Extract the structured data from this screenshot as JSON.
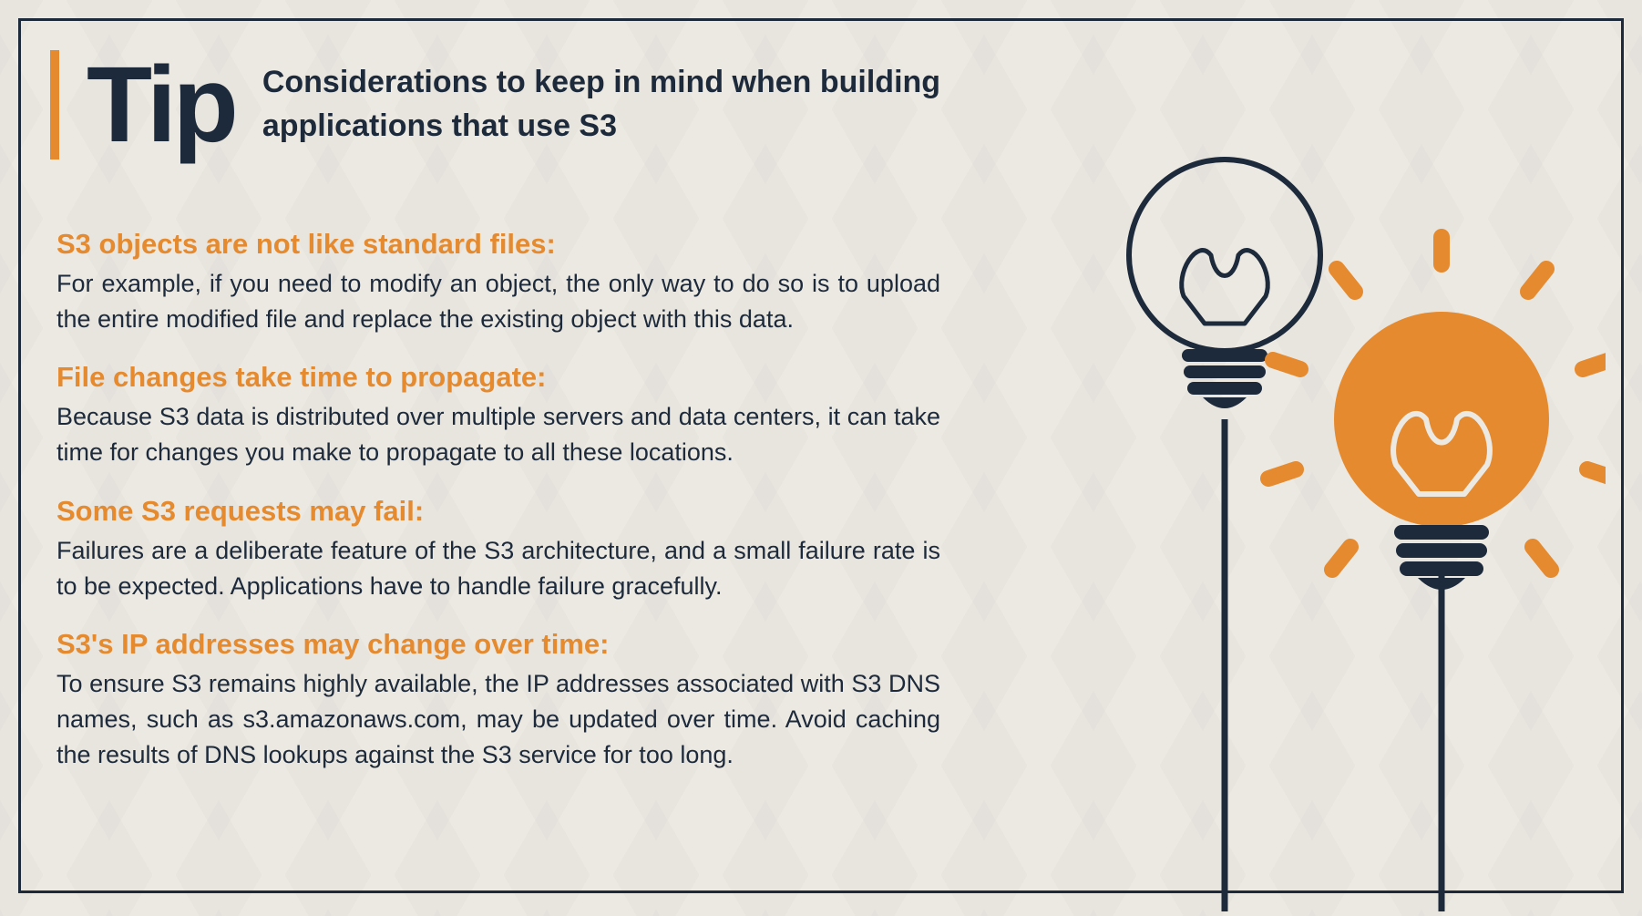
{
  "header": {
    "tip_label": "Tip",
    "subtitle": "Considerations to keep in mind when building applications that use S3"
  },
  "sections": [
    {
      "title": "S3 objects are not like standard files:",
      "body": "For example, if you need to modify an object, the only way to do so is to upload the entire modified file and replace the existing object with this data."
    },
    {
      "title": "File changes take time to propagate:",
      "body": "Because S3 data is distributed over multiple servers and data centers, it can take time for changes you make to propagate to all these locations."
    },
    {
      "title": "Some S3 requests may fail:",
      "body": "Failures are a deliberate feature of the S3 architecture, and a small failure rate is to be expected. Applications have to handle failure gracefully."
    },
    {
      "title": "S3's IP addresses may change over time:",
      "body": "To ensure S3 remains highly available, the IP addresses associated with S3 DNS names, such as s3.amazonaws.com, may be updated over time.  Avoid caching the results of DNS lookups against the S3 service for too long."
    }
  ],
  "colors": {
    "accent": "#e58a2f",
    "navy": "#1d2a3b",
    "bg": "#ece9e3"
  }
}
